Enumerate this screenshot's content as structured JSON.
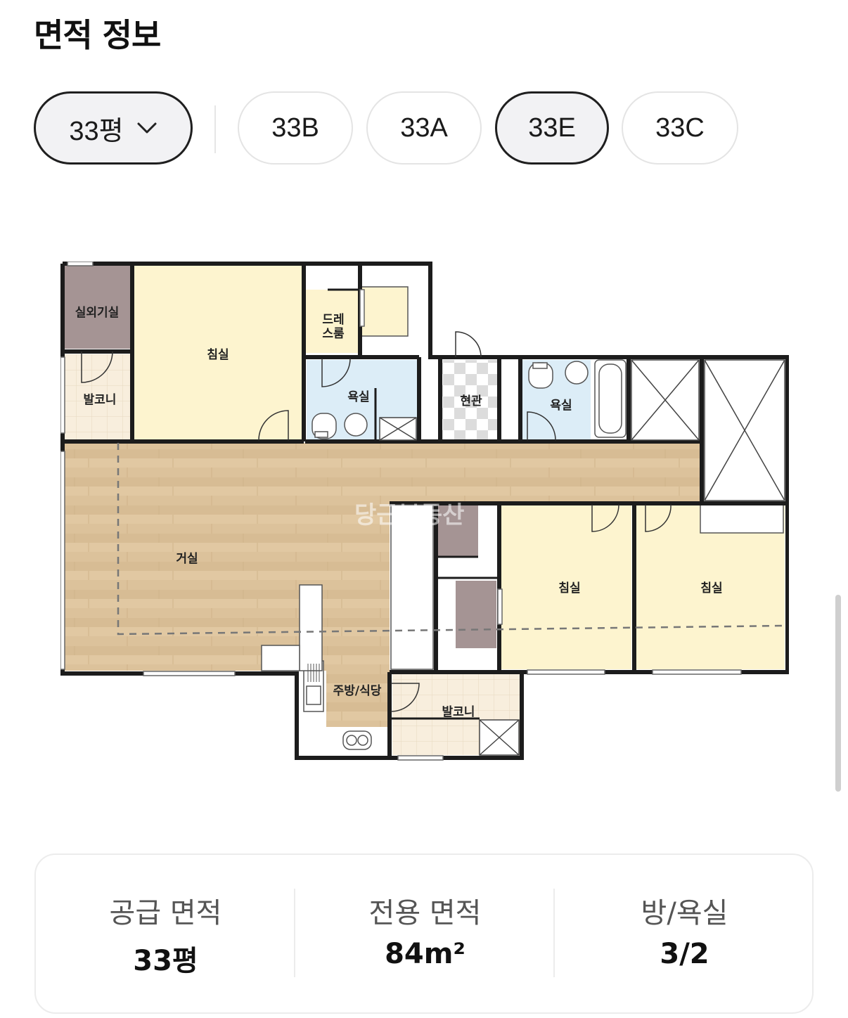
{
  "page": {
    "title": "면적 정보"
  },
  "chips": {
    "size_selector": "33평",
    "types": [
      {
        "label": "33B",
        "selected": false
      },
      {
        "label": "33A",
        "selected": false
      },
      {
        "label": "33E",
        "selected": true
      },
      {
        "label": "33C",
        "selected": false
      }
    ]
  },
  "floorplan": {
    "watermark": "당근부동산",
    "rooms": {
      "outdoor_unit": "실외기실",
      "bedroom_master": "침실",
      "dressroom_line1": "드레",
      "dressroom_line2": "스룸",
      "balcony_left": "발코니",
      "bath_1": "욕실",
      "entrance": "현관",
      "bath_2": "욕실",
      "living": "거실",
      "bedroom_2": "침실",
      "bedroom_3": "침실",
      "kitchen": "주방/식당",
      "balcony_bottom": "발코니"
    },
    "colors": {
      "wood": "#dcc29b",
      "bedroom": "#fdf4cf",
      "bath": "#dcedf7",
      "tile": "#f8eedd",
      "outdoor": "#a59494",
      "wall": "#1c1c1c"
    }
  },
  "info": {
    "supply_area_label": "공급 면적",
    "supply_area_value": "33평",
    "exclusive_area_label": "전용 면적",
    "exclusive_area_value": "84m²",
    "rooms_baths_label": "방/욕실",
    "rooms_baths_value": "3/2"
  }
}
